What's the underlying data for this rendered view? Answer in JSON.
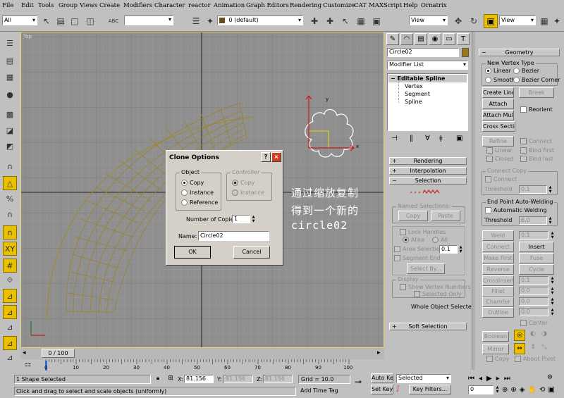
{
  "menu": [
    "File",
    "Edit",
    "Tools",
    "Group",
    "Views",
    "Create",
    "Modifiers",
    "Character",
    "reactor",
    "Animation",
    "Graph Editors",
    "Rendering",
    "Customize",
    "CAT",
    "MAXScript",
    "Help",
    "Ornatrix"
  ],
  "toolbar": {
    "selection_filter": "All",
    "layer_dropdown": "0 (default)",
    "ref_coord_left": "View",
    "ref_coord_right": "View",
    "abc_label": "ABC"
  },
  "viewport": {
    "label": "Top",
    "overlay_text": [
      "通过缩放复制",
      "得到一个新的",
      "circle02"
    ],
    "axis_x": "x",
    "axis_y": "y"
  },
  "dialog": {
    "title": "Clone Options",
    "help": "?",
    "close": "×",
    "object_group": "Object",
    "object_options": [
      "Copy",
      "Instance",
      "Reference"
    ],
    "object_selected": "Copy",
    "controller_group": "Controller",
    "controller_options": [
      "Copy",
      "Instance"
    ],
    "copies_label": "Number of Copies:",
    "copies_value": "1",
    "name_label": "Name:",
    "name_value": "Circle02",
    "ok": "OK",
    "cancel": "Cancel"
  },
  "command_panel": {
    "object_name": "Circle02",
    "object_color": "#9a7a1a",
    "modifier_list": "Modifier List",
    "stack": {
      "root": "Editable Spline",
      "children": [
        "Vertex",
        "Segment",
        "Spline"
      ]
    },
    "rollouts": {
      "rendering": "Rendering",
      "interpolation": "Interpolation",
      "selection": "Selection",
      "soft_selection": "Soft Selection"
    },
    "selection": {
      "named_group": "Named Selections:",
      "copy": "Copy",
      "paste": "Paste",
      "lock_handles": "Lock Handles",
      "alike": "Alike",
      "all": "All",
      "area_selection": "Area Selection:",
      "area_value": "0.1",
      "segment_end": "Segment End",
      "select_by": "Select By...",
      "display_group": "Display",
      "show_vertex_numbers": "Show Vertex Numbers",
      "selected_only": "Selected Only",
      "whole_object": "Whole Object Selected"
    }
  },
  "geometry": {
    "title": "Geometry",
    "new_vertex_type": "New Vertex Type",
    "types": [
      "Linear",
      "Bezier",
      "Smooth",
      "Bezier Corner"
    ],
    "type_selected": "Linear",
    "create_line": "Create Line",
    "break": "Break",
    "attach": "Attach",
    "reorient": "Reorient",
    "attach_mult": "Attach Mult.",
    "cross_section": "Cross Section",
    "refine": "Refine",
    "connect": "Connect",
    "linear": "Linear",
    "bind_first": "Bind first",
    "closed": "Closed",
    "bind_last": "Bind last",
    "connect_copy": "Connect Copy",
    "connect_chk": "Connect",
    "threshold": "Threshold",
    "threshold_value": "0.1",
    "end_point": "End Point Auto-Welding",
    "auto_welding": "Automatic Welding",
    "threshold2": "Threshold",
    "threshold2_value": "6.0",
    "weld": "Weld",
    "weld_value": "0.1",
    "connect_btn": "Connect",
    "insert": "Insert",
    "make_first": "Make First",
    "fuse": "Fuse",
    "reverse": "Reverse",
    "cycle": "Cycle",
    "crossinsert": "CrossInsert",
    "crossinsert_value": "0.1",
    "fillet": "Fillet",
    "fillet_value": "0.0",
    "chamfer": "Chamfer",
    "chamfer_value": "0.0",
    "outline": "Outline",
    "outline_value": "0.0",
    "center": "Center",
    "boolean": "Boolean",
    "mirror": "Mirror",
    "copy": "Copy",
    "about_pivot": "About Pivot"
  },
  "timeline": {
    "slider": "0 / 100",
    "ticks": [
      "0",
      "10",
      "20",
      "30",
      "40",
      "50",
      "60",
      "70",
      "80",
      "90",
      "100"
    ]
  },
  "status": {
    "selected": "1 Shape Selected",
    "prompt": "Click and drag to select and scale objects (uniformly)",
    "x_label": "X:",
    "x_value": "81.156",
    "y_label": "Y:",
    "y_value": "81.156",
    "z_label": "Z:",
    "z_value": "81.156",
    "grid": "Grid = 10.0",
    "add_time_tag": "Add Time Tag",
    "auto_key": "Auto Key",
    "set_key": "Set Key",
    "selected_dropdown": "Selected",
    "key_filters": "Key Filters...",
    "frame": "0"
  }
}
